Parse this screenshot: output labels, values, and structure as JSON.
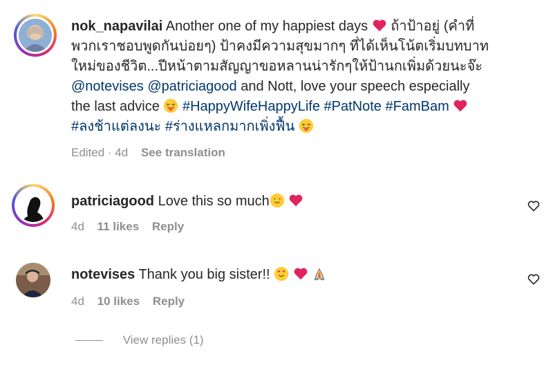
{
  "post": {
    "username": "nok_napavilai",
    "text_lines": [
      "Another one of my happiest days",
      "ถ้าป้าอยู่ (คำที่",
      "พวกเราชอบพูดกันบ่อยๆ) ป้าคงมีความสุขมากๆ ที่ได้เห็นโน้ตเริ่มบทบาท",
      "ใหม่ของชีวิต...ปีหน้าตามสัญญาขอหลานน่ารักๆให้ป้านกเพิ่มด้วยนะจ๊ะ"
    ],
    "mention1": "@notevises",
    "mention2": "@patriciagood",
    "text_after_mentions": "and Nott, love your speech especially",
    "text_last_advice": "the last advice",
    "hashtags_line1": "#HappyWifeHappyLife #PatNote #FamBam",
    "hashtags_line2": "#ลงช้าแต่ลงนะ #ร่างแหลกมากเพิ่งฟื้น",
    "meta_edited": "Edited · 4d",
    "meta_translate": "See translation"
  },
  "comments": [
    {
      "username": "patriciagood",
      "text": "Love this so much",
      "time": "4d",
      "likes": "11 likes",
      "reply": "Reply"
    },
    {
      "username": "notevises",
      "text": "Thank you big sister!!",
      "time": "4d",
      "likes": "10 likes",
      "reply": "Reply"
    }
  ],
  "view_replies": "View replies (1)",
  "colors": {
    "link": "#00376b",
    "muted": "#8e8e8e",
    "heart": "#ed4956"
  }
}
